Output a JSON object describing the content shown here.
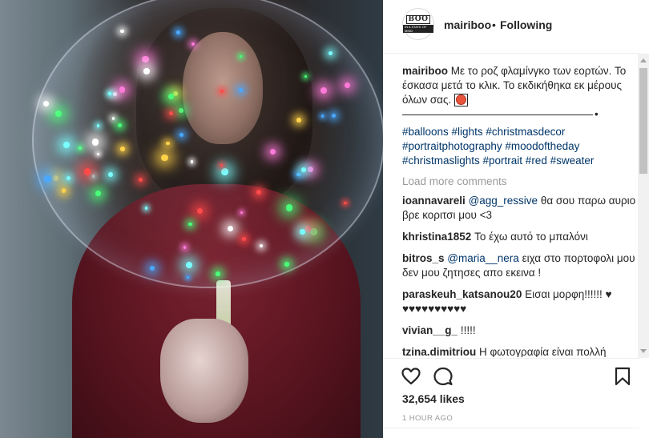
{
  "post": {
    "username": "mairiboo",
    "separator": "•",
    "follow_status": "Following",
    "avatar_text": "BOO",
    "avatar_sub": "IN A STATE OF MIND",
    "caption_text": "Με το ροζ φλαμίνγκο των εορτών. Το έσκασα μετά το κλικ. Το εκδικήθηκα εκ μέρους όλων σας.",
    "caption_end": "•",
    "hashtags": "#balloons #lights #christmasdecor #portraitphotography #moodoftheday #christmaslights #portrait #red #sweater",
    "load_more": "Load more comments",
    "comments": [
      {
        "user": "ioannavareli",
        "mention": "@agg_ressive",
        "text": "θα σου παρω αυριο βρε κοριτσι μου <3"
      },
      {
        "user": "khristina1852",
        "mention": "",
        "text": "Το έχω αυτό το μπαλόνι"
      },
      {
        "user": "bitros_s",
        "mention": "@maria__nera",
        "text": "ειχα στο πορτοφολι μου δεν μου ζητησες απο εκεινα !"
      },
      {
        "user": "paraskeuh_katsanou20",
        "mention": "",
        "text": "Εισαι μορφη!!!!!! ♥ ♥♥♥♥♥♥♥♥♥♥"
      },
      {
        "user": "vivian__g_",
        "mention": "",
        "text": "!!!!!"
      },
      {
        "user": "tzina.dimitriou",
        "mention": "",
        "text": "Η φωτογραφία είναι πολλή ομορφηηηη♥αλλά και εσυ είσαι"
      }
    ],
    "likes": "32,654 likes",
    "time": "1 HOUR AGO"
  },
  "colors": {
    "accent_link": "#003569",
    "muted": "#999999",
    "heart_emoji": "#e8457a"
  },
  "icons": [
    "heart-icon",
    "comment-icon",
    "bookmark-icon"
  ]
}
